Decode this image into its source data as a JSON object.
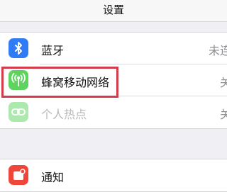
{
  "header": {
    "title": "设置"
  },
  "group1": {
    "items": [
      {
        "label": "蓝牙",
        "value": "未连",
        "icon": "bluetooth-icon",
        "icon_color": "#2f7cf6"
      },
      {
        "label": "蜂窝移动网络",
        "value": "关",
        "icon": "cellular-icon",
        "icon_color": "#5ed45e"
      },
      {
        "label": "个人热点",
        "value": "关",
        "icon": "personal-hotspot-icon",
        "icon_color": "#5ed45e"
      }
    ]
  },
  "group2": {
    "items": [
      {
        "label": "通知",
        "icon": "notifications-icon",
        "icon_color": "#f0463a"
      }
    ]
  },
  "highlight": {
    "color": "#d23b4a"
  }
}
